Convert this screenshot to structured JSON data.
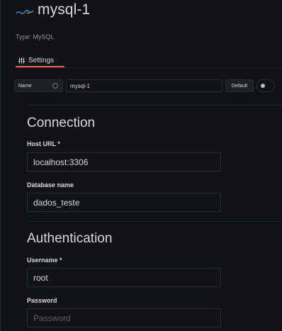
{
  "header": {
    "title": "mysql-1",
    "type_line": "Type: MySQL"
  },
  "tabs": [
    {
      "label": "Settings",
      "icon": "sliders-icon",
      "active": true
    }
  ],
  "name_row": {
    "label": "Name",
    "value": "mysql-1",
    "default_label": "Default",
    "default_enabled": false
  },
  "connection": {
    "title": "Connection",
    "host_label": "Host URL *",
    "host_value": "localhost:3306",
    "db_label": "Database name",
    "db_value": "dados_teste"
  },
  "authentication": {
    "title": "Authentication",
    "username_label": "Username *",
    "username_value": "root",
    "password_label": "Password",
    "password_placeholder": "Password"
  },
  "colors": {
    "accent": "#f55f3e",
    "background": "#111217",
    "logo_blue": "#1f9bd1"
  }
}
